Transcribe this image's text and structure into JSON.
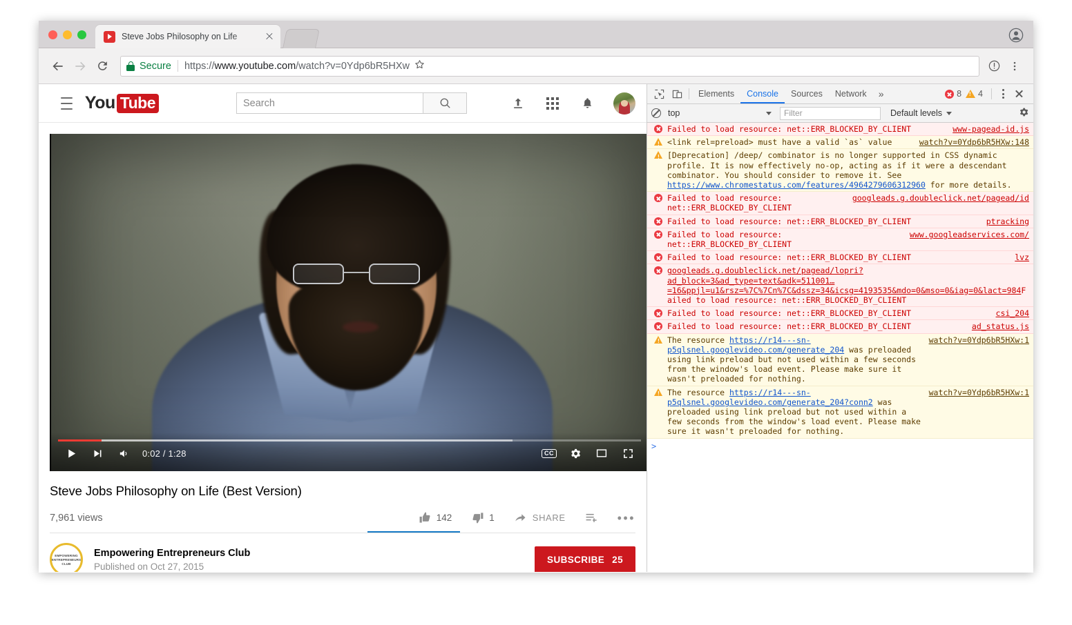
{
  "browser": {
    "tab": {
      "title": "Steve Jobs Philosophy on Life",
      "close_label": "×"
    },
    "omnibox": {
      "secure_label": "Secure",
      "url_scheme": "https://",
      "url_host": "www.youtube.com",
      "url_path": "/watch?v=0Ydp6bR5HXw"
    }
  },
  "youtube": {
    "search": {
      "placeholder": "Search"
    },
    "logo": {
      "you": "You",
      "tube": "Tube"
    },
    "player": {
      "time": "0:02 / 1:28",
      "current_time": "0:02",
      "duration": "1:28",
      "cc_label": "CC"
    },
    "video": {
      "title": "Steve Jobs Philosophy on Life (Best Version)",
      "views": "7,961 views",
      "likes": "142",
      "dislikes": "1",
      "share_label": "SHARE"
    },
    "channel": {
      "name": "Empowering Entrepreneurs Club",
      "published": "Published on Oct 27, 2015",
      "avatar_line1": "EMPOWERING",
      "avatar_line2": "ENTREPRENEURS",
      "avatar_line3": "CLUB",
      "subscribe_label": "SUBSCRIBE",
      "subscriber_count": "25"
    }
  },
  "devtools": {
    "tabs": [
      {
        "label": "Elements",
        "active": false
      },
      {
        "label": "Console",
        "active": true
      },
      {
        "label": "Sources",
        "active": false
      },
      {
        "label": "Network",
        "active": false
      }
    ],
    "more_label": "»",
    "error_count": "8",
    "warning_count": "4",
    "filterbar": {
      "context": "top",
      "filter_placeholder": "Filter",
      "levels": "Default levels"
    },
    "prompt": ">",
    "messages": [
      {
        "level": "error",
        "text": "Failed to load resource: net::ERR_BLOCKED_BY_CLIENT",
        "source": "www-pagead-id.js",
        "source_color": "red"
      },
      {
        "level": "warn",
        "text": "<link rel=preload> must have a valid `as` value",
        "source": "watch?v=0Ydp6bR5HXw:148",
        "source_color": "brown"
      },
      {
        "level": "warn",
        "text": "[Deprecation] /deep/ combinator is no longer supported in CSS dynamic profile. It is now effectively no-op, acting as if it were a descendant combinator. You should consider to remove it. See ",
        "link": "https://www.chromestatus.com/features/4964279606312960",
        "text_after": " for more details.",
        "source": "",
        "source_color": "brown"
      },
      {
        "level": "error",
        "text": "Failed to load resource: net::ERR_BLOCKED_BY_CLIENT",
        "source": "googleads.g.doubleclick.net/pagead/id",
        "source_color": "red",
        "two_line": true
      },
      {
        "level": "error",
        "text": "Failed to load resource: net::ERR_BLOCKED_BY_CLIENT",
        "source": "ptracking",
        "source_color": "red"
      },
      {
        "level": "error",
        "text": "Failed to load resource: net::ERR_BLOCKED_BY_CLIENT",
        "source": "www.googleadservices.com/",
        "source_color": "red",
        "two_line": true
      },
      {
        "level": "error",
        "text": "Failed to load resource: net::ERR_BLOCKED_BY_CLIENT",
        "source": "lvz",
        "source_color": "red"
      },
      {
        "level": "error",
        "link": "googleads.g.doubleclick.net/pagead/lopri?ad_block=3&ad_type=text&adk=511001…=16&ppjl=u1&rsz=%7C%7Cn%7C&dssz=34&icsg=4193535&mdo=0&mso=0&iag=0&lact=984",
        "text_after": "Failed to load resource: net::ERR_BLOCKED_BY_CLIENT",
        "source": "",
        "source_color": "red"
      },
      {
        "level": "error",
        "text": "Failed to load resource: net::ERR_BLOCKED_BY_CLIENT",
        "source": "csi_204",
        "source_color": "red"
      },
      {
        "level": "error",
        "text": "Failed to load resource: net::ERR_BLOCKED_BY_CLIENT",
        "source": "ad_status.js",
        "source_color": "red"
      },
      {
        "level": "warn",
        "text": "The resource ",
        "link": "https://r14---sn-p5qlsnel.googlevideo.com/generate_204",
        "text_after": " was preloaded using link preload but not used within a few seconds from the window's load event. Please make sure it wasn't preloaded for nothing.",
        "source": "watch?v=0Ydp6bR5HXw:1",
        "source_color": "brown"
      },
      {
        "level": "warn",
        "text": "The resource ",
        "link": "https://r14---sn-p5qlsnel.googlevideo.com/generate_204?conn2",
        "text_after": " was preloaded using link preload but not used within a few seconds from the window's load event. Please make sure it wasn't preloaded for nothing.",
        "source": "watch?v=0Ydp6bR5HXw:1",
        "source_color": "brown"
      }
    ]
  },
  "colors": {
    "youtube_red": "#cc181e",
    "devtools_blue": "#1a73e8",
    "error_red": "#c00000",
    "warn_brown": "#5c3c00",
    "secure_green": "#0b8043"
  }
}
